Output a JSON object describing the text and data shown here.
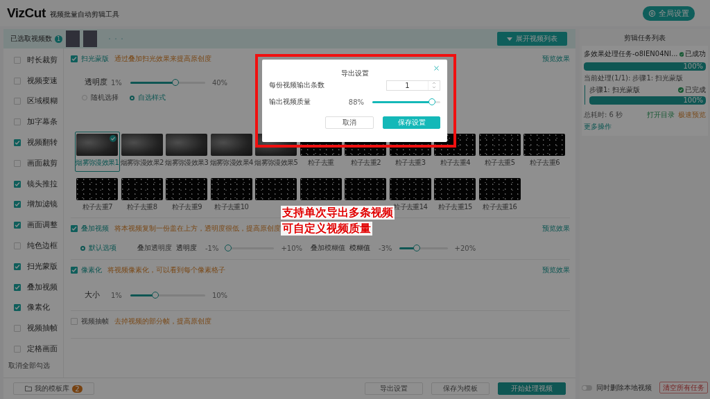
{
  "app": {
    "logo": "VizCut",
    "subtitle": "视频批量自动剪辑工具",
    "settings_button": "全局设置"
  },
  "selection_bar": {
    "label": "已选取视频数",
    "count": "1",
    "expand_button": "展开视频列表"
  },
  "sidebar": {
    "items": [
      {
        "label": "时长裁剪",
        "checked": false
      },
      {
        "label": "视频变速",
        "checked": false
      },
      {
        "label": "区域模糊",
        "checked": false
      },
      {
        "label": "加字幕条",
        "checked": false
      },
      {
        "label": "视频翻转",
        "checked": true
      },
      {
        "label": "画面裁剪",
        "checked": false
      },
      {
        "label": "镜头推拉",
        "checked": true
      },
      {
        "label": "增加滤镜",
        "checked": true
      },
      {
        "label": "画面调整",
        "checked": true
      },
      {
        "label": "纯色边框",
        "checked": false
      },
      {
        "label": "扫光蒙版",
        "checked": true
      },
      {
        "label": "叠加视频",
        "checked": true
      },
      {
        "label": "像素化",
        "checked": true
      },
      {
        "label": "视频抽帧",
        "checked": false
      },
      {
        "label": "定格画面",
        "checked": false
      }
    ],
    "clear_link": "取消全部勾选"
  },
  "sections": [
    {
      "kind": "gallery",
      "title": "扫光蒙版",
      "checked": true,
      "description": "通过叠加扫光效果来提高原创度",
      "preview": "预览效果",
      "sliders": [
        {
          "label": "透明度",
          "min": "1%",
          "max": "40%",
          "level": 0.6
        }
      ],
      "radios": [
        {
          "label": "随机选择",
          "selected": false
        },
        {
          "label": "自选样式",
          "selected": true
        }
      ],
      "thumbnails": [
        {
          "label": "烟雾弥漫效果1",
          "kind": "smoke",
          "selected": true
        },
        {
          "label": "烟雾弥漫效果2",
          "kind": "smoke",
          "selected": false
        },
        {
          "label": "烟雾弥漫效果3",
          "kind": "smoke",
          "selected": false
        },
        {
          "label": "烟雾弥漫效果4",
          "kind": "smoke",
          "selected": false
        },
        {
          "label": "烟雾弥漫效果5",
          "kind": "smoke",
          "selected": false
        },
        {
          "label": "粒子去重",
          "kind": "particle",
          "selected": false
        },
        {
          "label": "粒子去重2",
          "kind": "particle",
          "selected": false
        },
        {
          "label": "粒子去重3",
          "kind": "particle",
          "selected": false
        },
        {
          "label": "粒子去重4",
          "kind": "particle",
          "selected": false
        },
        {
          "label": "粒子去重5",
          "kind": "particle",
          "selected": false
        },
        {
          "label": "粒子去重6",
          "kind": "particle",
          "selected": false
        },
        {
          "label": "粒子去重7",
          "kind": "particle",
          "selected": false
        },
        {
          "label": "粒子去重8",
          "kind": "particle",
          "selected": false
        },
        {
          "label": "粒子去重9",
          "kind": "particle",
          "selected": false
        },
        {
          "label": "粒子去重10",
          "kind": "particle",
          "selected": false
        },
        {
          "kind": "particle",
          "selected": false
        },
        {
          "kind": "particle",
          "selected": false
        },
        {
          "kind": "particle",
          "selected": false
        },
        {
          "label": "粒子去重14",
          "kind": "particle",
          "selected": false
        },
        {
          "label": "粒子去重15",
          "kind": "particle",
          "selected": false
        },
        {
          "label": "粒子去重16",
          "kind": "particle",
          "selected": false
        }
      ]
    },
    {
      "kind": "inline",
      "title": "叠加视频",
      "checked": true,
      "description": "将本视频复制一份盖在上方，透明度很低，提高原创度",
      "preview": "预览效果",
      "radios": [
        {
          "label": "默认选项",
          "selected": true
        }
      ],
      "sliders": [
        {
          "caption": "叠加透明度",
          "label": "透明度",
          "min": "-1%",
          "max": "+10%",
          "level": 0.05
        },
        {
          "caption": "叠加模糊值",
          "label": "模糊值",
          "min": "-3%",
          "max": "+20%",
          "level": 0.36
        }
      ]
    },
    {
      "kind": "stacked",
      "title": "像素化",
      "checked": true,
      "description": "将视频像素化，可以看到每个像素格子",
      "preview": "预览效果",
      "sliders": [
        {
          "label": "大小",
          "min": "1%",
          "max": "10%",
          "level": 0.33
        }
      ]
    },
    {
      "kind": "plain",
      "title": "视频抽帧",
      "checked": false,
      "description": "去掉视频的部分帧，提高原创度"
    }
  ],
  "bottom_bar": {
    "template_library": {
      "label": "我的模板库",
      "count": "2"
    },
    "actions": [
      {
        "label": "导出设置",
        "kind": "secondary"
      },
      {
        "label": "保存为模板",
        "kind": "secondary"
      },
      {
        "label": "开始处理视频",
        "kind": "primary"
      }
    ]
  },
  "tasks": {
    "title": "剪辑任务列表",
    "task": {
      "name": "多效果处理任务-o8IEN04NI...",
      "status": "已成功",
      "level": 1,
      "percent": "100%",
      "current": "当前处理(1/1): 步骤1:  扫光蒙版",
      "steps": [
        {
          "name": "步骤1:  扫光蒙版",
          "status": "已完成",
          "level": 1,
          "percent": "100%"
        }
      ],
      "duration": "总耗时: 6 秒",
      "links": [
        {
          "label": "打开目录",
          "kind": "open"
        },
        {
          "label": "极速预览",
          "kind": "preview"
        },
        {
          "label": "更多操作",
          "kind": "more"
        }
      ]
    },
    "delete_toggle": {
      "label": "同时删除本地视频",
      "on": false
    },
    "clear_button": "清空所有任务"
  },
  "dialog": {
    "title": "导出设置",
    "fields": [
      {
        "kind": "number",
        "label": "每份视频输出条数",
        "value": "1"
      },
      {
        "kind": "slider",
        "label": "输出视频质量",
        "reading": "88%",
        "level": 0.88
      }
    ],
    "buttons": [
      {
        "label": "取消",
        "kind": "secondary"
      },
      {
        "label": "保存设置",
        "kind": "primary"
      }
    ]
  },
  "annotation": {
    "lines": [
      "支持单次导出多条视频",
      "可自定义视频质量"
    ]
  }
}
